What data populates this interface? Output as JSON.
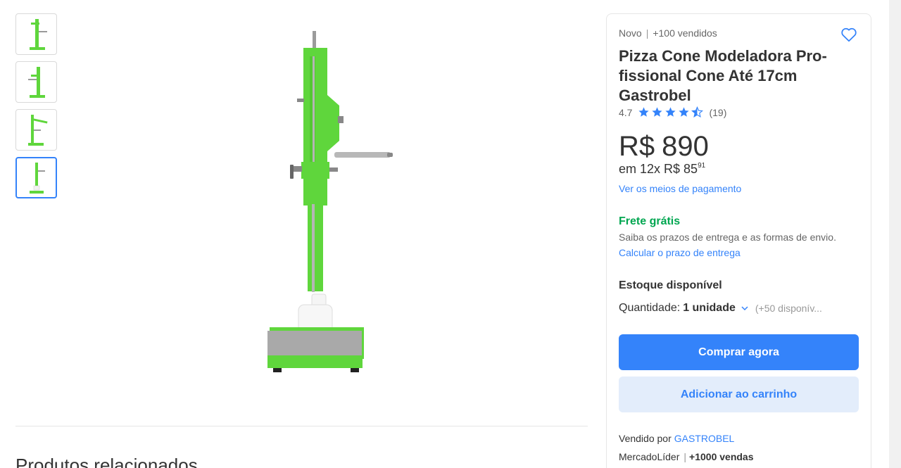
{
  "gallery": {
    "thumbnails": [
      {
        "name": "thumb-1",
        "active": false
      },
      {
        "name": "thumb-2",
        "active": false
      },
      {
        "name": "thumb-3",
        "active": false
      },
      {
        "name": "thumb-4",
        "active": true
      }
    ],
    "product_color": "#5fd63c"
  },
  "related": {
    "title": "Produtos relacionados"
  },
  "product": {
    "condition": "Novo",
    "sold": "+100 vendidos",
    "title": "Pizza Cone Modeladora Pro­fissional Cone Até 17cm Gastrobel",
    "rating": "4.7",
    "rating_stars": 4.5,
    "reviews": "(19)",
    "currency": "R$",
    "price": "890",
    "installments_prefix": "em 12x R$ 85",
    "installments_cents": "91",
    "payment_link": "Ver os meios de pagamento"
  },
  "shipping": {
    "title": "Frete grátis",
    "info": "Saiba os prazos de entrega e as formas de envio.",
    "link": "Calcular o prazo de entrega"
  },
  "stock": {
    "title": "Estoque disponível",
    "quantity_label": "Quantidade:",
    "quantity_value": "1 unidade",
    "available": "(+50 disponív..."
  },
  "actions": {
    "buy_now": "Comprar agora",
    "add_to_cart": "Adicionar ao carrinho"
  },
  "seller": {
    "sold_by": "Vendido por",
    "name": "GASTROBEL",
    "badge": "MercadoLíder",
    "sales": "+1000 vendas"
  },
  "colors": {
    "accent": "#3483fa",
    "free_shipping": "#00a650",
    "secondary_button": "#e3edfb"
  }
}
